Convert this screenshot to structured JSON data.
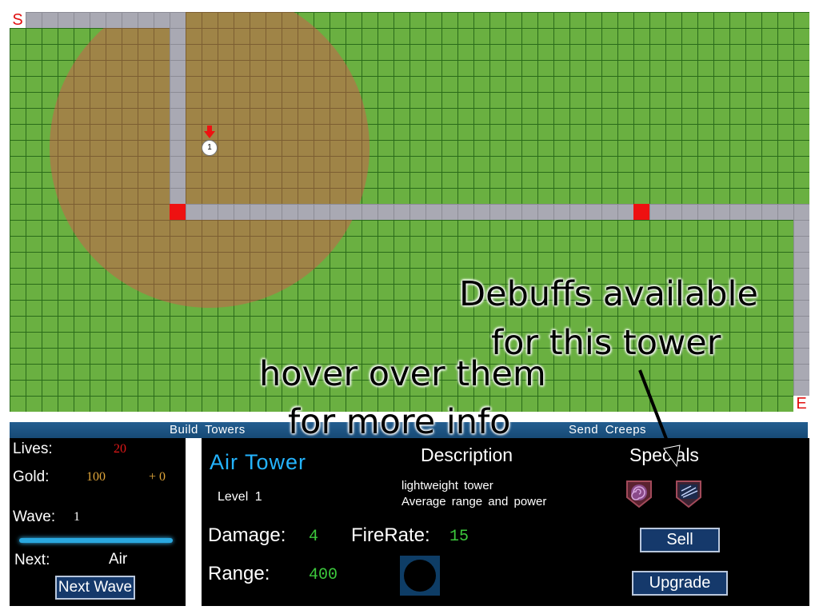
{
  "map": {
    "start_marker": "S",
    "end_marker": "E",
    "creep": {
      "label": "1"
    },
    "colors": {
      "grass": "#6ab041",
      "path": "#a9a9b3",
      "waypoint": "#ee1111",
      "range": "#e15050"
    }
  },
  "menu_bar": {
    "build_towers": "Build Towers",
    "send_creeps": "Send Creeps"
  },
  "stats": {
    "lives_label": "Lives:",
    "lives_value": "20",
    "gold_label": "Gold:",
    "gold_value": "100",
    "gold_income": "+ 0",
    "wave_label": "Wave:",
    "wave_value": "1",
    "next_label": "Next:",
    "next_value": "Air",
    "next_wave_button": "Next Wave"
  },
  "tower_info": {
    "name": "Air Tower",
    "level": "Level 1",
    "description_heading": "Description",
    "description_line1": "lightweight tower",
    "description_line2": "Average range and power",
    "specials_heading": "Specials",
    "damage_label": "Damage:",
    "damage_value": "4",
    "firerate_label": "FireRate:",
    "firerate_value": "15",
    "range_label": "Range:",
    "range_value": "400",
    "sell_button": "Sell",
    "upgrade_button": "Upgrade",
    "specials_icons": [
      "vortex-icon",
      "wind-icon"
    ]
  },
  "annotations": {
    "debuffs_line1": "Debuffs available",
    "debuffs_line2": "for this tower",
    "hover_line1": "hover over them",
    "hover_line2": "for more info"
  }
}
